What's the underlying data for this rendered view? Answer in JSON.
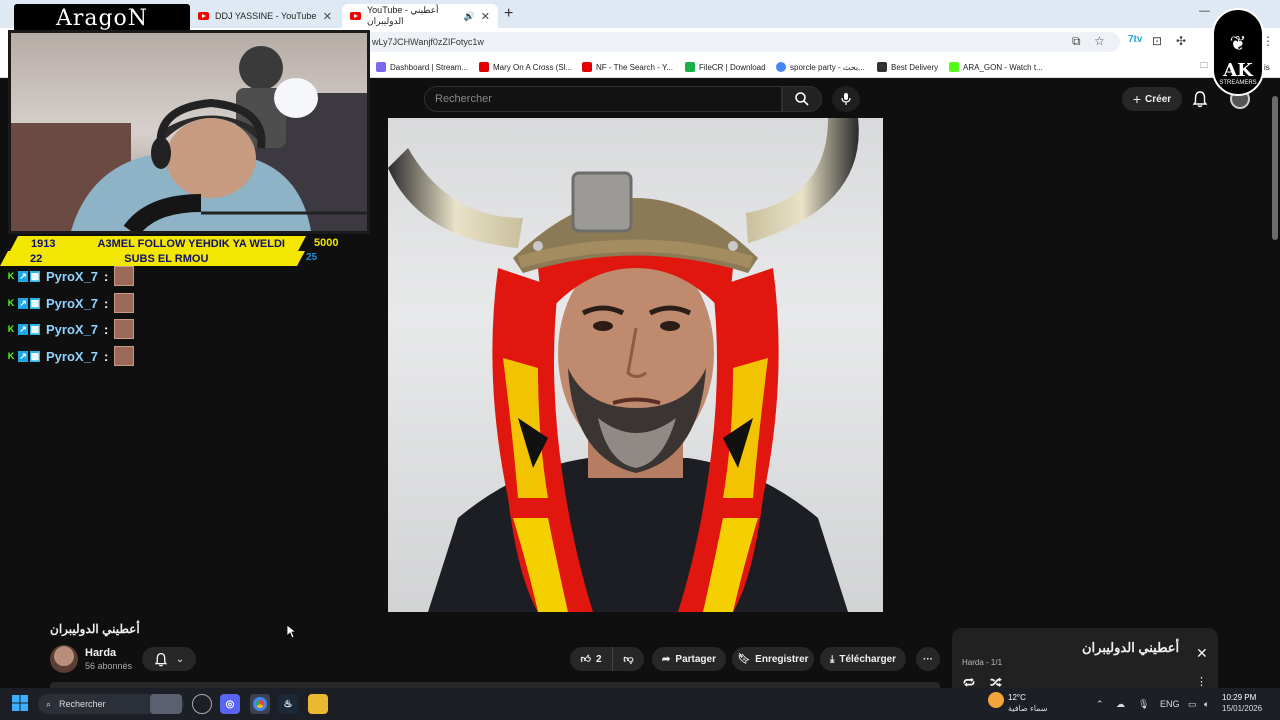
{
  "browser": {
    "tabs": [
      {
        "label": "DDJ YASSINE - YouTube",
        "active": false
      },
      {
        "label": "YouTube - أعطيني الدوليبران",
        "active": true
      }
    ],
    "url": "wLy7JCHWanjf0zZIFotyc1w",
    "bookmarks": [
      {
        "label": "Dashboard | Stream...",
        "color": "#7b68ee"
      },
      {
        "label": "Mary On A Cross (Sl...",
        "color": "#e00000"
      },
      {
        "label": "NF - The Search - Y...",
        "color": "#e00000"
      },
      {
        "label": "FileCR | Download",
        "color": "#18b04a"
      },
      {
        "label": "sporcle party - بحث...",
        "color": "#4285f4"
      },
      {
        "label": "Best Delivery",
        "color": "#333333"
      },
      {
        "label": "ARA_GON - Watch t...",
        "color": "#53fc18"
      }
    ],
    "bookmarks_overflow": "is"
  },
  "youtube": {
    "search_placeholder": "Rechercher",
    "create_label": "Créer"
  },
  "overlay": {
    "logo": "AragoN",
    "follow_count": "1913",
    "follow_text": "A3MEL FOLLOW YEHDIK YA WELDI",
    "follow_goal": "5000",
    "subs_count": "22",
    "subs_text": "SUBS EL RMOU",
    "subs_goal": "25",
    "chat": [
      {
        "user": "PyroX_7",
        "colon": ":"
      },
      {
        "user": "PyroX_7",
        "colon": ":"
      },
      {
        "user": "PyroX_7",
        "colon": ":"
      },
      {
        "user": "PyroX_7",
        "colon": ":"
      }
    ],
    "ak_logo": "AK",
    "ak_sub": "STREAMERS"
  },
  "video": {
    "title": "أعطيني الدوليبران",
    "channel": "Harda",
    "subscribers": "56 abonnés",
    "likes": "2",
    "share": "Partager",
    "save": "Enregistrer",
    "download": "Télécharger"
  },
  "playlist": {
    "title": "أعطيني الدوليبران",
    "meta": "Harda - 1/1"
  },
  "taskbar": {
    "search": "Rechercher",
    "weather_temp": "12°C",
    "weather_desc": "سماء صافية",
    "lang": "ENG",
    "time": "10:29 PM",
    "date": "15/01/2026"
  },
  "colors": {
    "yt_bg": "#0f0f0f",
    "overlay_yellow": "#f3e600",
    "chat_name": "#8fd3ff",
    "kick_green": "#53fc18"
  }
}
